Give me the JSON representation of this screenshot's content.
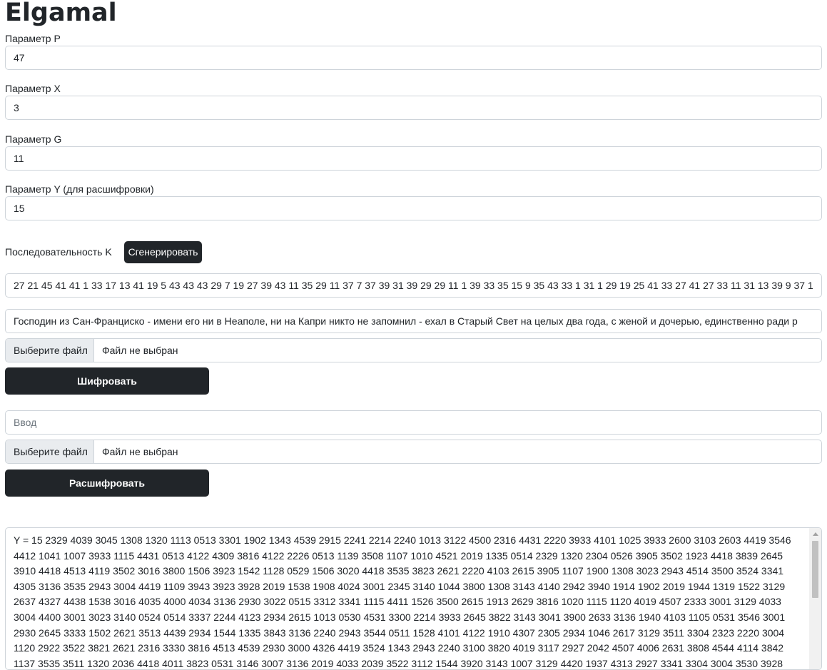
{
  "page": {
    "title": "Elgamal"
  },
  "params": {
    "p_label": "Параметр P",
    "p_value": "47",
    "x_label": "Параметр X",
    "x_value": "3",
    "g_label": "Параметр G",
    "g_value": "11",
    "y_label": "Параметр Y (для расшифровки)",
    "y_value": "15"
  },
  "sequence": {
    "label": "Последовательность K",
    "generate_button": "Сгенерировать",
    "value": "27 21 45 41 41 1 33 17 13 41 19 5 43 43 43 29 7 19 27 39 43 11 35 29 11 37 7 37 39 31 39 29 29 11 1 39 33 35 15 9 35 43 33 1 31 1 29 19 25 41 33 27 41 27 33 11 31 13 39 9 37 1"
  },
  "encrypt": {
    "text_value": "Господин из Сан-Франциско - имени его ни в Неаполе, ни на Капри никто не запомнил - ехал в Старый Свет на целых два года, с женой и дочерью, единственно ради р",
    "file_button": "Выберите файл",
    "file_status": "Файл не выбран",
    "button": "Шифровать"
  },
  "decrypt": {
    "input_placeholder": "Ввод",
    "file_button": "Выберите файл",
    "file_status": "Файл не выбран",
    "button": "Расшифровать"
  },
  "output": {
    "text": "Y = 15 2329 4039 3045 1308 1320 1113 0513 3301 1902 1343 4539 2915 2241 2214 2240 1013 3122 4500 2316 4431 2220 3933 4101 1025 3933 2600 3103 2603 4419 3546 4412 1041 1007 3933 1115 4431 0513 4122 4309 3816 4122 2226 0513 1139 3508 1107 1010 4521 2019 1335 0514 2329 1320 2304 0526 3905 3502 1923 4418 3839 2645 3910 4418 4513 4119 3502 3016 3800 1506 3923 1542 1128 0529 1506 3020 4418 3535 3823 2621 2220 4103 2615 3905 1107 1900 1308 3023 2943 4514 3500 3524 3341 4305 3136 3535 2943 3004 4419 1109 3943 3923 3928 2019 1538 1908 4024 3001 2345 3140 1044 3800 1308 3143 4140 2942 3940 1914 1902 2019 1944 1319 1522 3129 2637 4327 4438 1538 3016 4035 4000 4034 3136 2930 3022 0515 3312 3341 1115 4411 1526 3500 2615 1913 2629 3816 1020 1115 1120 4019 4507 2333 3001 3129 4033 3004 4400 3001 3023 3140 0524 0514 3337 2244 4123 2934 2615 1013 0530 4531 3300 2214 3933 2645 3822 3143 3041 3900 2633 3136 1940 4103 1105 0531 3546 3001 2930 2645 3333 1502 2621 3513 4439 2934 1544 1335 3843 3136 2240 2943 3544 0511 1528 4101 4122 1910 4307 2305 2934 1046 2617 3129 3511 3304 2323 2220 3004 1120 2922 3522 3821 2621 2316 3330 3816 4513 4539 2930 3000 4326 4419 3524 1343 2943 2240 3100 3820 4019 3117 2927 2042 4507 4006 2631 3808 4544 4114 3842 1137 3535 3511 1320 2036 4418 4011 3823 0531 3146 3007 3136 2019 4033 2039 3522 3112 1544 3920 3143 1007 3129 4420 1937 4313 2927 3341 3304 3004 3530 3928"
  }
}
